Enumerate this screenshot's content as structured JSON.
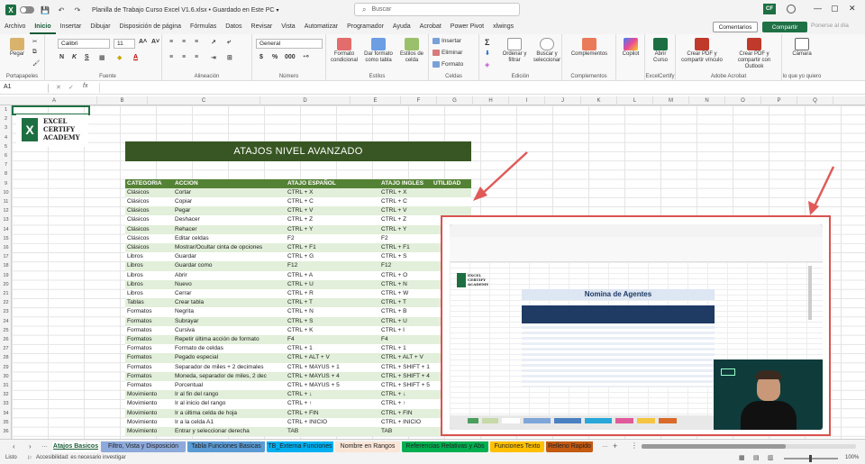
{
  "titlebar": {
    "autosave_label": "Autoguardado",
    "document_title": "Planilla de Trabajo Curso Excel V1.6.xlsx • Guardado en Este PC",
    "search_placeholder": "Buscar",
    "ext_label": "CF"
  },
  "menu": {
    "tabs": [
      "Archivo",
      "Inicio",
      "Insertar",
      "Dibujar",
      "Disposición de página",
      "Fórmulas",
      "Datos",
      "Revisar",
      "Vista",
      "Automatizar",
      "Programador",
      "Ayuda",
      "Acrobat",
      "Power Pivot",
      "xlwings"
    ],
    "active_index": 1,
    "comments_label": "Comentarios",
    "share_label": "Compartir",
    "online_label": "Ponerse al día"
  },
  "ribbon": {
    "clipboard": {
      "paste": "Pegar",
      "group": "Portapapeles"
    },
    "font": {
      "name": "Calibri",
      "size": "11",
      "group": "Fuente"
    },
    "alignment": {
      "group": "Alineación"
    },
    "number": {
      "format": "General",
      "group": "Número"
    },
    "styles": {
      "conditional": "Formato condicional",
      "as_table": "Dar formato como tabla",
      "cell_styles": "Estilos de celda",
      "group": "Estilos"
    },
    "cells": {
      "insert": "Insertar",
      "delete": "Eliminar",
      "format": "Formato",
      "group": "Celdas"
    },
    "editing": {
      "sort": "Ordenar y filtrar",
      "find": "Buscar y seleccionar",
      "group": "Edición"
    },
    "addins": {
      "complements": "Complementos",
      "group": "Complementos"
    },
    "copilot": {
      "label": "Copilot"
    },
    "excelcertify": {
      "open": "Abrir Curso",
      "group": "ExcelCertify"
    },
    "acrobat": {
      "pdf_link": "Crear PDF y compartir vínculo",
      "pdf_outlook": "Crear PDF y compartir con Outlook",
      "group": "Adobe Acrobat"
    },
    "camera": {
      "label": "Cámara",
      "group": "lo que yo quiero"
    }
  },
  "formula_bar": {
    "cell_ref": "A1",
    "fx": "fx"
  },
  "columns": [
    "A",
    "B",
    "C",
    "D",
    "E",
    "F",
    "G",
    "H",
    "I",
    "J",
    "K",
    "L",
    "M",
    "N",
    "O",
    "P",
    "Q"
  ],
  "rows_start": 1,
  "rows_count": 36,
  "logo": {
    "line1": "EXCEL",
    "line2": "CERTIFY",
    "line3": "ACADEMY"
  },
  "banner_title": "ATAJOS NIVEL AVANZADO",
  "table": {
    "headers": [
      "CATEGORIA",
      "ACCION",
      "ATAJO ESPAÑOL",
      "ATAJO INGLES",
      "UTILIDAD"
    ],
    "rows": [
      [
        "Clásicos",
        "Cortar",
        "CTRL + X",
        "CTRL + X",
        ""
      ],
      [
        "Clásicos",
        "Copiar",
        "CTRL + C",
        "CTRL + C",
        ""
      ],
      [
        "Clásicos",
        "Pegar",
        "CTRL + V",
        "CTRL + V",
        ""
      ],
      [
        "Clásicos",
        "Deshacer",
        "CTRL + Z",
        "CTRL + Z",
        ""
      ],
      [
        "Clásicos",
        "Rehacer",
        "CTRL + Y",
        "CTRL + Y",
        ""
      ],
      [
        "Clásicos",
        "Editar celdas",
        "F2",
        "F2",
        ""
      ],
      [
        "Clásicos",
        "Mostrar/Ocultar cinta de opciones",
        "CTRL + F1",
        "CTRL + F1",
        ""
      ],
      [
        "Libros",
        "Guardar",
        "CTRL + G",
        "CTRL + S",
        ""
      ],
      [
        "Libros",
        "Guardar como",
        "F12",
        "F12",
        ""
      ],
      [
        "Libros",
        "Abrir",
        "CTRL + A",
        "CTRL + O",
        ""
      ],
      [
        "Libros",
        "Nuevo",
        "CTRL + U",
        "CTRL + N",
        ""
      ],
      [
        "Libros",
        "Cerrar",
        "CTRL + R",
        "CTRL + W",
        ""
      ],
      [
        "Tablas",
        "Crear tabla",
        "CTRL + T",
        "CTRL + T",
        ""
      ],
      [
        "Formatos",
        "Negrita",
        "CTRL + N",
        "CTRL + B",
        ""
      ],
      [
        "Formatos",
        "Subrayar",
        "CTRL + S",
        "CTRL + U",
        ""
      ],
      [
        "Formatos",
        "Cursiva",
        "CTRL + K",
        "CTRL + I",
        ""
      ],
      [
        "Formatos",
        "Repetir última acción de formato",
        "F4",
        "F4",
        ""
      ],
      [
        "Formatos",
        "Formato de celdas",
        "CTRL + 1",
        "CTRL + 1",
        ""
      ],
      [
        "Formatos",
        "Pegado especial",
        "CTRL + ALT + V",
        "CTRL + ALT + V",
        ""
      ],
      [
        "Formatos",
        "Separador de miles + 2 decimales",
        "CTRL + MAYUS + 1",
        "CTRL + SHIFT + 1",
        ""
      ],
      [
        "Formatos",
        "Moneda, separador de miles, 2 dec",
        "CTRL + MAYUS + 4",
        "CTRL + SHIFT + 4",
        ""
      ],
      [
        "Formatos",
        "Porcentual",
        "CTRL + MAYUS + 5",
        "CTRL + SHIFT + 5",
        ""
      ],
      [
        "Movimiento",
        "Ir al fin del rango",
        "CTRL + ↓",
        "CTRL + ↓",
        ""
      ],
      [
        "Movimiento",
        "Ir al inicio del rango",
        "CTRL + ↑",
        "CTRL + ↑",
        ""
      ],
      [
        "Movimiento",
        "Ir a última celda de hoja",
        "CTRL + FIN",
        "CTRL + FIN",
        ""
      ],
      [
        "Movimiento",
        "Ir a la celda A1",
        "CTRL + INICIO",
        "CTRL + INICIO",
        ""
      ],
      [
        "Movimiento",
        "Entrar y seleccionar derecha",
        "TAB",
        "TAB",
        ""
      ]
    ]
  },
  "video": {
    "title": "Nomina de Agentes",
    "logo_line1": "EXCEL",
    "logo_line2": "CERTIFY",
    "logo_line3": "ACADEMY"
  },
  "sheet_tabs": [
    {
      "label": "Atajos Basicos",
      "color": "#ffffff",
      "active": true
    },
    {
      "label": "Filtro, Vista y Disposición",
      "color": "#8eaadb"
    },
    {
      "label": "Tabla Funciones Basicas",
      "color": "#5b9bd5"
    },
    {
      "label": "TB_Externa Funciones",
      "color": "#00b0f0"
    },
    {
      "label": "Nombre en Rangos",
      "color": "#fbe5d6"
    },
    {
      "label": "Referencias Relativas y Abs",
      "color": "#00b050"
    },
    {
      "label": "Funciones Texto",
      "color": "#ffc000"
    },
    {
      "label": "Relleno Rapido",
      "color": "#c55a11"
    }
  ],
  "status": {
    "ready": "Listo",
    "accessibility": "Accesibilidad: es necesario investigar",
    "zoom": "100%"
  }
}
